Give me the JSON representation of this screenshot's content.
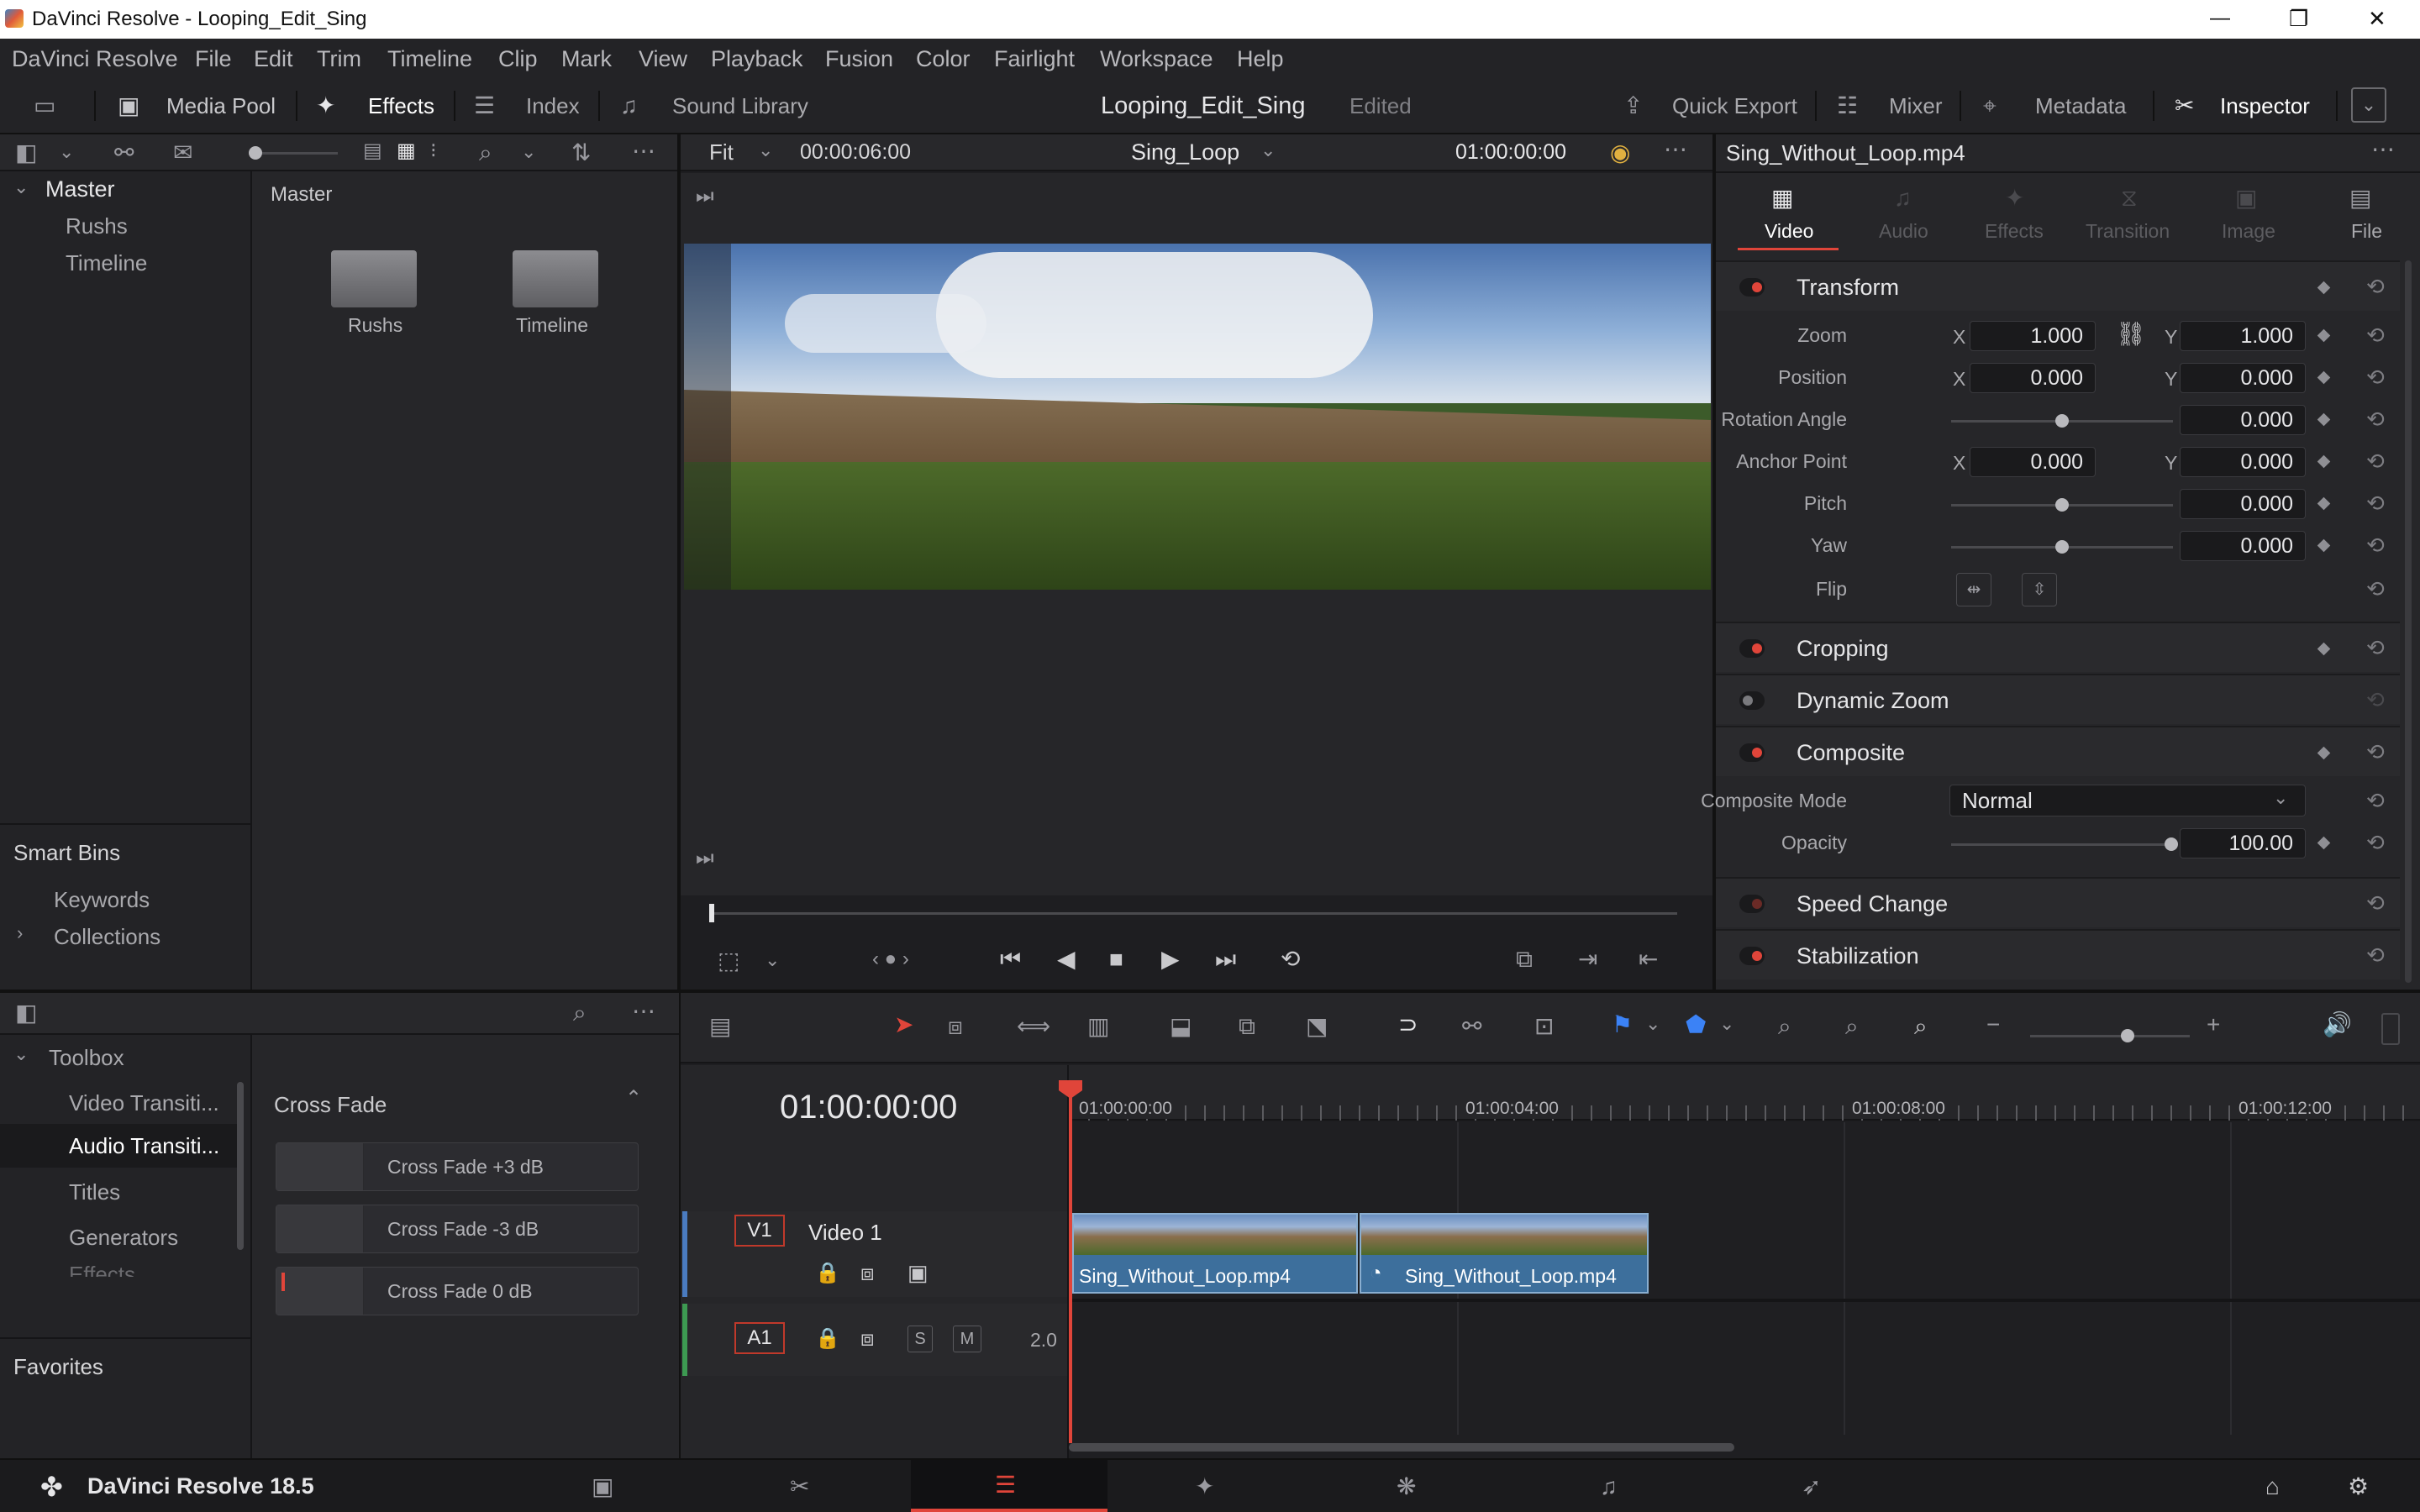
{
  "window": {
    "title": "DaVinci Resolve - Looping_Edit_Sing",
    "minimize": "—",
    "maximize": "❐",
    "close": "✕"
  },
  "menu": [
    "DaVinci Resolve",
    "File",
    "Edit",
    "Trim",
    "Timeline",
    "Clip",
    "Mark",
    "View",
    "Playback",
    "Fusion",
    "Color",
    "Fairlight",
    "Workspace",
    "Help"
  ],
  "toolbar": {
    "media_pool": "Media Pool",
    "effects": "Effects",
    "index": "Index",
    "sound_library": "Sound Library",
    "project_name": "Looping_Edit_Sing",
    "status": "Edited",
    "quick_export": "Quick Export",
    "mixer": "Mixer",
    "metadata": "Metadata",
    "inspector": "Inspector"
  },
  "bins": {
    "root": "Master",
    "items": [
      "Rushs",
      "Timeline"
    ],
    "smart_bins_title": "Smart Bins",
    "smart_bins": [
      "Keywords",
      "Collections"
    ]
  },
  "media_pool": {
    "path": "Master",
    "folders": [
      "Rushs",
      "Timeline"
    ]
  },
  "viewer": {
    "fit": "Fit",
    "duration": "00:00:06:00",
    "timeline_name": "Sing_Loop",
    "timecode": "01:00:00:00"
  },
  "inspector": {
    "clip_name": "Sing_Without_Loop.mp4",
    "tabs": [
      "Video",
      "Audio",
      "Effects",
      "Transition",
      "Image",
      "File"
    ],
    "transform": {
      "title": "Transform",
      "zoom_label": "Zoom",
      "zoom_x": "1.000",
      "zoom_y": "1.000",
      "position_label": "Position",
      "position_x": "0.000",
      "position_y": "0.000",
      "rotation_label": "Rotation Angle",
      "rotation": "0.000",
      "anchor_label": "Anchor Point",
      "anchor_x": "0.000",
      "anchor_y": "0.000",
      "pitch_label": "Pitch",
      "pitch": "0.000",
      "yaw_label": "Yaw",
      "yaw": "0.000",
      "flip_label": "Flip",
      "x": "X",
      "y": "Y"
    },
    "cropping": "Cropping",
    "dynamic_zoom": "Dynamic Zoom",
    "composite": {
      "title": "Composite",
      "mode_label": "Composite Mode",
      "mode": "Normal",
      "opacity_label": "Opacity",
      "opacity": "100.00"
    },
    "speed_change": "Speed Change",
    "stabilization": "Stabilization"
  },
  "toolbox": {
    "title": "Toolbox",
    "items": [
      "Video Transiti...",
      "Audio Transiti...",
      "Titles",
      "Generators",
      "Effects"
    ],
    "favorites": "Favorites"
  },
  "effects_list": {
    "category": "Cross Fade",
    "items": [
      "Cross Fade +3 dB",
      "Cross Fade -3 dB",
      "Cross Fade 0 dB"
    ]
  },
  "timeline": {
    "timecode": "01:00:00:00",
    "ruler": [
      "01:00:00:00",
      "01:00:04:00",
      "01:00:08:00",
      "01:00:12:00"
    ],
    "video_track": {
      "id": "V1",
      "name": "Video 1"
    },
    "audio_track": {
      "id": "A1",
      "solo": "S",
      "mute": "M",
      "channels": "2.0"
    },
    "clips": [
      "Sing_Without_Loop.mp4",
      "Sing_Without_Loop.mp4"
    ]
  },
  "footer": {
    "app": "DaVinci Resolve 18.5"
  }
}
